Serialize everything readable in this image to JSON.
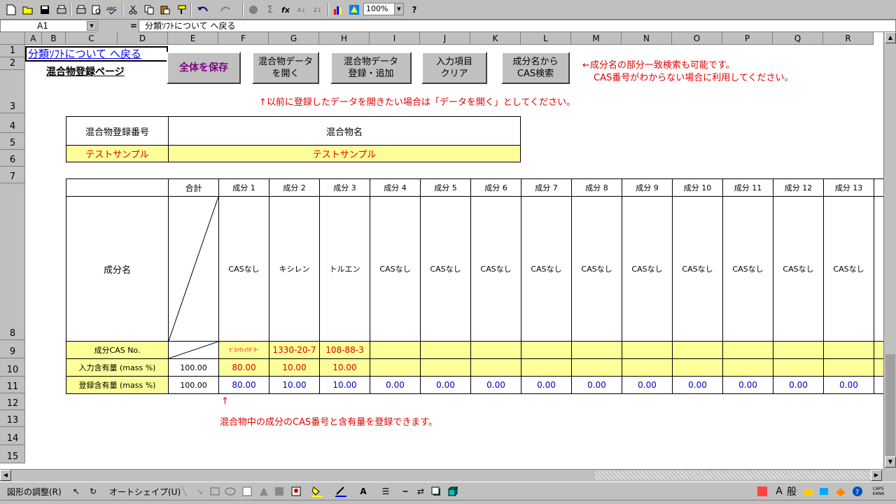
{
  "toolbar": {
    "zoom": "100%",
    "icons": [
      "new-icon",
      "open-icon",
      "save-icon",
      "print-setup-icon",
      "print-icon",
      "print-preview-icon",
      "spellcheck-icon",
      "cut-icon",
      "copy-icon",
      "paste-icon",
      "format-painter-icon",
      "undo-icon",
      "redo-icon",
      "hyperlink-icon",
      "autosum-icon",
      "function-icon",
      "sort-ascending-icon",
      "sort-descending-icon",
      "chart-icon",
      "map-icon",
      "help-icon"
    ]
  },
  "formula_bar": {
    "cell_ref": "A1",
    "equals": "=",
    "content": "分類ｿﾌﾄについて へ戻る"
  },
  "columns": [
    "A",
    "B",
    "C",
    "D",
    "E",
    "F",
    "G",
    "H",
    "I",
    "J",
    "K",
    "L",
    "M",
    "N",
    "O",
    "P",
    "Q",
    "R"
  ],
  "rows": [
    "1",
    "2",
    "3",
    "4",
    "5",
    "6",
    "7",
    "8",
    "9",
    "10",
    "11",
    "12",
    "13",
    "14",
    "15"
  ],
  "sheet": {
    "link": "分類ｿﾌﾄについて へ戻る",
    "heading": "混合物登録ページ",
    "buttons": {
      "save": "全体を保存",
      "open": [
        "混合物データ",
        "を開く"
      ],
      "register": [
        "混合物データ",
        "登録・追加"
      ],
      "clear": [
        "入力項目",
        "クリア"
      ],
      "cas_search": [
        "成分名から",
        "CAS検索"
      ]
    },
    "notes": {
      "search_line1": "←成分名の部分一致検索も可能です。",
      "search_line2": "CAS番号がわからない場合に利用してください。",
      "open_hint": "↑以前に登録したデータを開きたい場合は「データを開く」としてください。",
      "arrow": "↑",
      "bottom_hint": "混合物中の成分のCAS番号と含有量を登録できます。"
    },
    "mixture": {
      "number_label": "混合物登録番号",
      "name_label": "混合物名",
      "number_value": "テストサンプル",
      "name_value": "テストサンプル"
    },
    "component_table": {
      "total_label": "合計",
      "headers": [
        "成分 1",
        "成分 2",
        "成分 3",
        "成分 4",
        "成分 5",
        "成分 6",
        "成分 7",
        "成分 8",
        "成分 9",
        "成分 10",
        "成分 11",
        "成分 12",
        "成分 13"
      ],
      "name_row_label": "成分名",
      "names": [
        "CASなし",
        "キシレン",
        "トルエン",
        "CASなし",
        "CASなし",
        "CASなし",
        "CASなし",
        "CASなし",
        "CASなし",
        "CASなし",
        "CASなし",
        "CASなし",
        "CASなし"
      ],
      "cas_row_label": "成分CAS No.",
      "cas": [
        "ｾﾞﾛｿｳｼｮｳﾎﾞﾀｰ",
        "1330-20-7",
        "108-88-3",
        "",
        "",
        "",
        "",
        "",
        "",
        "",
        "",
        "",
        ""
      ],
      "input_row_label": "入力含有量 (mass %)",
      "input_total": "100.00",
      "input": [
        "80.00",
        "10.00",
        "10.00",
        "",
        "",
        "",
        "",
        "",
        "",
        "",
        "",
        "",
        ""
      ],
      "registered_row_label": "登録含有量 (mass %)",
      "registered_total": "100.00",
      "registered": [
        "80.00",
        "10.00",
        "10.00",
        "0.00",
        "0.00",
        "0.00",
        "0.00",
        "0.00",
        "0.00",
        "0.00",
        "0.00",
        "0.00",
        "0.00"
      ]
    }
  },
  "drawing_bar": {
    "adjust": "図形の調整(R)",
    "autoshape": "オートシェイプ(U)",
    "ime": "般"
  },
  "colors": {
    "red_text": "#e00000",
    "blue_text": "#0000c0",
    "yellow_fill": "#ffff99",
    "save_text": "#800080"
  }
}
